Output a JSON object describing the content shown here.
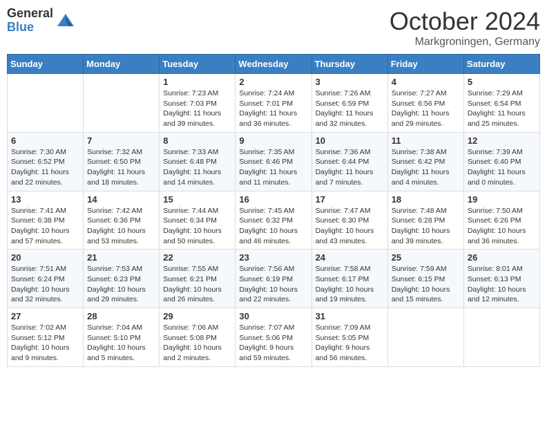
{
  "logo": {
    "general": "General",
    "blue": "Blue"
  },
  "title": {
    "month": "October 2024",
    "location": "Markgroningen, Germany"
  },
  "headers": [
    "Sunday",
    "Monday",
    "Tuesday",
    "Wednesday",
    "Thursday",
    "Friday",
    "Saturday"
  ],
  "weeks": [
    [
      {
        "day": "",
        "sunrise": "",
        "sunset": "",
        "daylight": ""
      },
      {
        "day": "",
        "sunrise": "",
        "sunset": "",
        "daylight": ""
      },
      {
        "day": "1",
        "sunrise": "Sunrise: 7:23 AM",
        "sunset": "Sunset: 7:03 PM",
        "daylight": "Daylight: 11 hours and 39 minutes."
      },
      {
        "day": "2",
        "sunrise": "Sunrise: 7:24 AM",
        "sunset": "Sunset: 7:01 PM",
        "daylight": "Daylight: 11 hours and 36 minutes."
      },
      {
        "day": "3",
        "sunrise": "Sunrise: 7:26 AM",
        "sunset": "Sunset: 6:59 PM",
        "daylight": "Daylight: 11 hours and 32 minutes."
      },
      {
        "day": "4",
        "sunrise": "Sunrise: 7:27 AM",
        "sunset": "Sunset: 6:56 PM",
        "daylight": "Daylight: 11 hours and 29 minutes."
      },
      {
        "day": "5",
        "sunrise": "Sunrise: 7:29 AM",
        "sunset": "Sunset: 6:54 PM",
        "daylight": "Daylight: 11 hours and 25 minutes."
      }
    ],
    [
      {
        "day": "6",
        "sunrise": "Sunrise: 7:30 AM",
        "sunset": "Sunset: 6:52 PM",
        "daylight": "Daylight: 11 hours and 22 minutes."
      },
      {
        "day": "7",
        "sunrise": "Sunrise: 7:32 AM",
        "sunset": "Sunset: 6:50 PM",
        "daylight": "Daylight: 11 hours and 18 minutes."
      },
      {
        "day": "8",
        "sunrise": "Sunrise: 7:33 AM",
        "sunset": "Sunset: 6:48 PM",
        "daylight": "Daylight: 11 hours and 14 minutes."
      },
      {
        "day": "9",
        "sunrise": "Sunrise: 7:35 AM",
        "sunset": "Sunset: 6:46 PM",
        "daylight": "Daylight: 11 hours and 11 minutes."
      },
      {
        "day": "10",
        "sunrise": "Sunrise: 7:36 AM",
        "sunset": "Sunset: 6:44 PM",
        "daylight": "Daylight: 11 hours and 7 minutes."
      },
      {
        "day": "11",
        "sunrise": "Sunrise: 7:38 AM",
        "sunset": "Sunset: 6:42 PM",
        "daylight": "Daylight: 11 hours and 4 minutes."
      },
      {
        "day": "12",
        "sunrise": "Sunrise: 7:39 AM",
        "sunset": "Sunset: 6:40 PM",
        "daylight": "Daylight: 11 hours and 0 minutes."
      }
    ],
    [
      {
        "day": "13",
        "sunrise": "Sunrise: 7:41 AM",
        "sunset": "Sunset: 6:38 PM",
        "daylight": "Daylight: 10 hours and 57 minutes."
      },
      {
        "day": "14",
        "sunrise": "Sunrise: 7:42 AM",
        "sunset": "Sunset: 6:36 PM",
        "daylight": "Daylight: 10 hours and 53 minutes."
      },
      {
        "day": "15",
        "sunrise": "Sunrise: 7:44 AM",
        "sunset": "Sunset: 6:34 PM",
        "daylight": "Daylight: 10 hours and 50 minutes."
      },
      {
        "day": "16",
        "sunrise": "Sunrise: 7:45 AM",
        "sunset": "Sunset: 6:32 PM",
        "daylight": "Daylight: 10 hours and 46 minutes."
      },
      {
        "day": "17",
        "sunrise": "Sunrise: 7:47 AM",
        "sunset": "Sunset: 6:30 PM",
        "daylight": "Daylight: 10 hours and 43 minutes."
      },
      {
        "day": "18",
        "sunrise": "Sunrise: 7:48 AM",
        "sunset": "Sunset: 6:28 PM",
        "daylight": "Daylight: 10 hours and 39 minutes."
      },
      {
        "day": "19",
        "sunrise": "Sunrise: 7:50 AM",
        "sunset": "Sunset: 6:26 PM",
        "daylight": "Daylight: 10 hours and 36 minutes."
      }
    ],
    [
      {
        "day": "20",
        "sunrise": "Sunrise: 7:51 AM",
        "sunset": "Sunset: 6:24 PM",
        "daylight": "Daylight: 10 hours and 32 minutes."
      },
      {
        "day": "21",
        "sunrise": "Sunrise: 7:53 AM",
        "sunset": "Sunset: 6:23 PM",
        "daylight": "Daylight: 10 hours and 29 minutes."
      },
      {
        "day": "22",
        "sunrise": "Sunrise: 7:55 AM",
        "sunset": "Sunset: 6:21 PM",
        "daylight": "Daylight: 10 hours and 26 minutes."
      },
      {
        "day": "23",
        "sunrise": "Sunrise: 7:56 AM",
        "sunset": "Sunset: 6:19 PM",
        "daylight": "Daylight: 10 hours and 22 minutes."
      },
      {
        "day": "24",
        "sunrise": "Sunrise: 7:58 AM",
        "sunset": "Sunset: 6:17 PM",
        "daylight": "Daylight: 10 hours and 19 minutes."
      },
      {
        "day": "25",
        "sunrise": "Sunrise: 7:59 AM",
        "sunset": "Sunset: 6:15 PM",
        "daylight": "Daylight: 10 hours and 15 minutes."
      },
      {
        "day": "26",
        "sunrise": "Sunrise: 8:01 AM",
        "sunset": "Sunset: 6:13 PM",
        "daylight": "Daylight: 10 hours and 12 minutes."
      }
    ],
    [
      {
        "day": "27",
        "sunrise": "Sunrise: 7:02 AM",
        "sunset": "Sunset: 5:12 PM",
        "daylight": "Daylight: 10 hours and 9 minutes."
      },
      {
        "day": "28",
        "sunrise": "Sunrise: 7:04 AM",
        "sunset": "Sunset: 5:10 PM",
        "daylight": "Daylight: 10 hours and 5 minutes."
      },
      {
        "day": "29",
        "sunrise": "Sunrise: 7:06 AM",
        "sunset": "Sunset: 5:08 PM",
        "daylight": "Daylight: 10 hours and 2 minutes."
      },
      {
        "day": "30",
        "sunrise": "Sunrise: 7:07 AM",
        "sunset": "Sunset: 5:06 PM",
        "daylight": "Daylight: 9 hours and 59 minutes."
      },
      {
        "day": "31",
        "sunrise": "Sunrise: 7:09 AM",
        "sunset": "Sunset: 5:05 PM",
        "daylight": "Daylight: 9 hours and 56 minutes."
      },
      {
        "day": "",
        "sunrise": "",
        "sunset": "",
        "daylight": ""
      },
      {
        "day": "",
        "sunrise": "",
        "sunset": "",
        "daylight": ""
      }
    ]
  ]
}
